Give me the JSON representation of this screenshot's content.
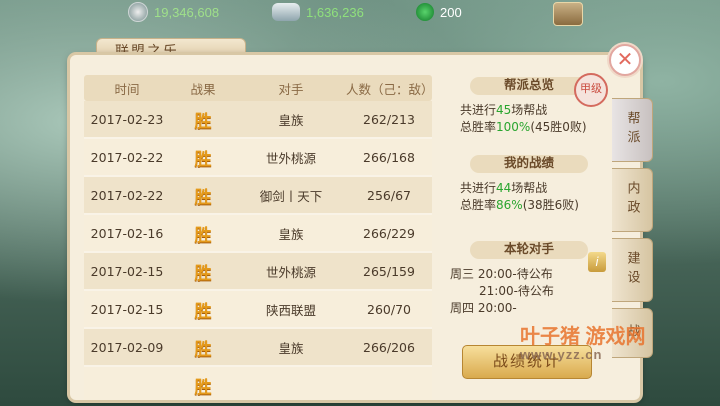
{
  "resources": {
    "silver": "19,346,608",
    "gold": "1,636,236",
    "jade": "200"
  },
  "panel_title": "联盟之乐",
  "table": {
    "headers": [
      "时间",
      "战果",
      "对手",
      "人数（己：敌）"
    ],
    "rows": [
      {
        "date": "2017-02-23",
        "result": "胜",
        "opponent": "皇族",
        "count": "262/213"
      },
      {
        "date": "2017-02-22",
        "result": "胜",
        "opponent": "世外桃源",
        "count": "266/168"
      },
      {
        "date": "2017-02-22",
        "result": "胜",
        "opponent": "御剑丨天下",
        "count": "256/67"
      },
      {
        "date": "2017-02-16",
        "result": "胜",
        "opponent": "皇族",
        "count": "266/229"
      },
      {
        "date": "2017-02-15",
        "result": "胜",
        "opponent": "世外桃源",
        "count": "265/159"
      },
      {
        "date": "2017-02-15",
        "result": "胜",
        "opponent": "陕西联盟",
        "count": "260/70"
      },
      {
        "date": "2017-02-09",
        "result": "胜",
        "opponent": "皇族",
        "count": "266/206"
      },
      {
        "date": "",
        "result": "胜",
        "opponent": "",
        "count": ""
      }
    ]
  },
  "summary": {
    "overview_title": "帮派总览",
    "overview_line1_pre": "共进行",
    "overview_line1_num": "45",
    "overview_line1_post": "场帮战",
    "overview_line2_pre": "总胜率",
    "overview_line2_num": "100%",
    "overview_line2_post": "(45胜0败)",
    "mine_title": "我的战绩",
    "mine_line1_pre": "共进行",
    "mine_line1_num": "44",
    "mine_line1_post": "场帮战",
    "mine_line2_pre": "总胜率",
    "mine_line2_num": "86%",
    "mine_line2_post": "(38胜6败)",
    "round_title": "本轮对手",
    "round_lines": [
      "周三 20:00-待公布",
      "21:00-待公布",
      "周四 20:00-"
    ],
    "seal": "甲级",
    "button": "战绩统计"
  },
  "tabs": [
    "帮派",
    "内政",
    "建设",
    "战"
  ],
  "watermark": {
    "name": "叶子猪 游戏网",
    "url": "www.yzz.cn"
  }
}
